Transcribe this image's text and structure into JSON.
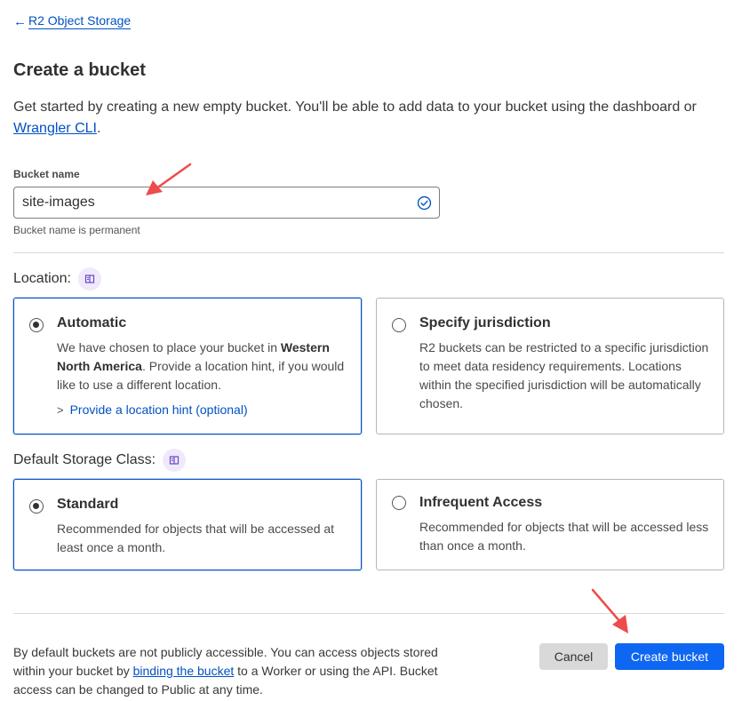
{
  "breadcrumb": {
    "arrow": "←",
    "label": "R2 Object Storage"
  },
  "page": {
    "title": "Create a bucket"
  },
  "intro": {
    "text_before": "Get started by creating a new empty bucket. You'll be able to add data to your bucket using the dashboard or ",
    "link": "Wrangler CLI",
    "text_after": "."
  },
  "bucket_name": {
    "label": "Bucket name",
    "value": "site-images",
    "hint": "Bucket name is permanent",
    "valid_icon": "check-circle-icon"
  },
  "location": {
    "label": "Location:",
    "info_icon": "book-icon",
    "options": [
      {
        "title": "Automatic",
        "selected": true,
        "desc_before": "We have chosen to place your bucket in ",
        "desc_bold": "Western North America",
        "desc_after": ". Provide a location hint, if you would like to use a different location.",
        "link_chevron": ">",
        "link": "Provide a location hint (optional)"
      },
      {
        "title": "Specify jurisdiction",
        "selected": false,
        "desc": "R2 buckets can be restricted to a specific jurisdiction to meet data residency requirements. Locations within the specified jurisdiction will be automatically chosen."
      }
    ]
  },
  "storage_class": {
    "label": "Default Storage Class:",
    "info_icon": "book-icon",
    "options": [
      {
        "title": "Standard",
        "selected": true,
        "desc": "Recommended for objects that will be accessed at least once a month."
      },
      {
        "title": "Infrequent Access",
        "selected": false,
        "desc": "Recommended for objects that will be accessed less than once a month."
      }
    ]
  },
  "footer": {
    "text_before": "By default buckets are not publicly accessible. You can access objects stored within your bucket by ",
    "link": "binding the bucket",
    "text_after": " to a Worker or using the API. Bucket access can be changed to Public at any time."
  },
  "actions": {
    "cancel_label": "Cancel",
    "create_label": "Create bucket"
  },
  "colors": {
    "accent": "#0051c3",
    "primary_button": "#0e67f2",
    "annotation_arrow": "#ee4b4b",
    "info_badge_bg": "#efe9fb"
  }
}
